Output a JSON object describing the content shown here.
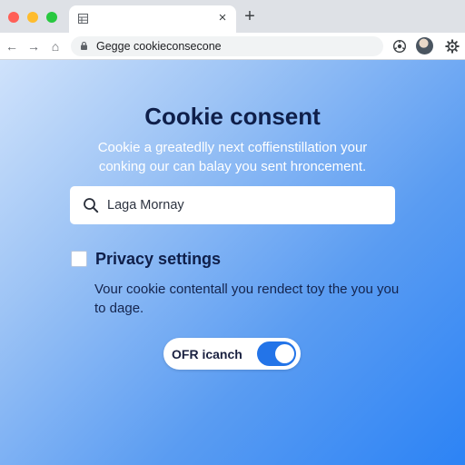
{
  "browser": {
    "url": "Gegge cookieconsecone",
    "tab_close_glyph": "×",
    "new_tab_glyph": "+",
    "nav": {
      "back": "←",
      "forward": "→",
      "home": "⌂"
    }
  },
  "page": {
    "title": "Cookie consent",
    "subtitle": "Cookie a greatedlly next coffienstillation your conking our can balay you sent hroncement.",
    "search": {
      "value": "Laga Mornay",
      "icon": "search-icon"
    },
    "privacy": {
      "checked": false,
      "heading": "Privacy settings",
      "description": "Vour cookie contentall you rendect toy the you you to dage."
    },
    "toggle": {
      "label": "OFR icanch",
      "on": true
    }
  },
  "colors": {
    "accent": "#2374e8",
    "heading": "#0f1f4a",
    "gradient_start": "#cfe2fb",
    "gradient_end": "#2c83f5"
  }
}
